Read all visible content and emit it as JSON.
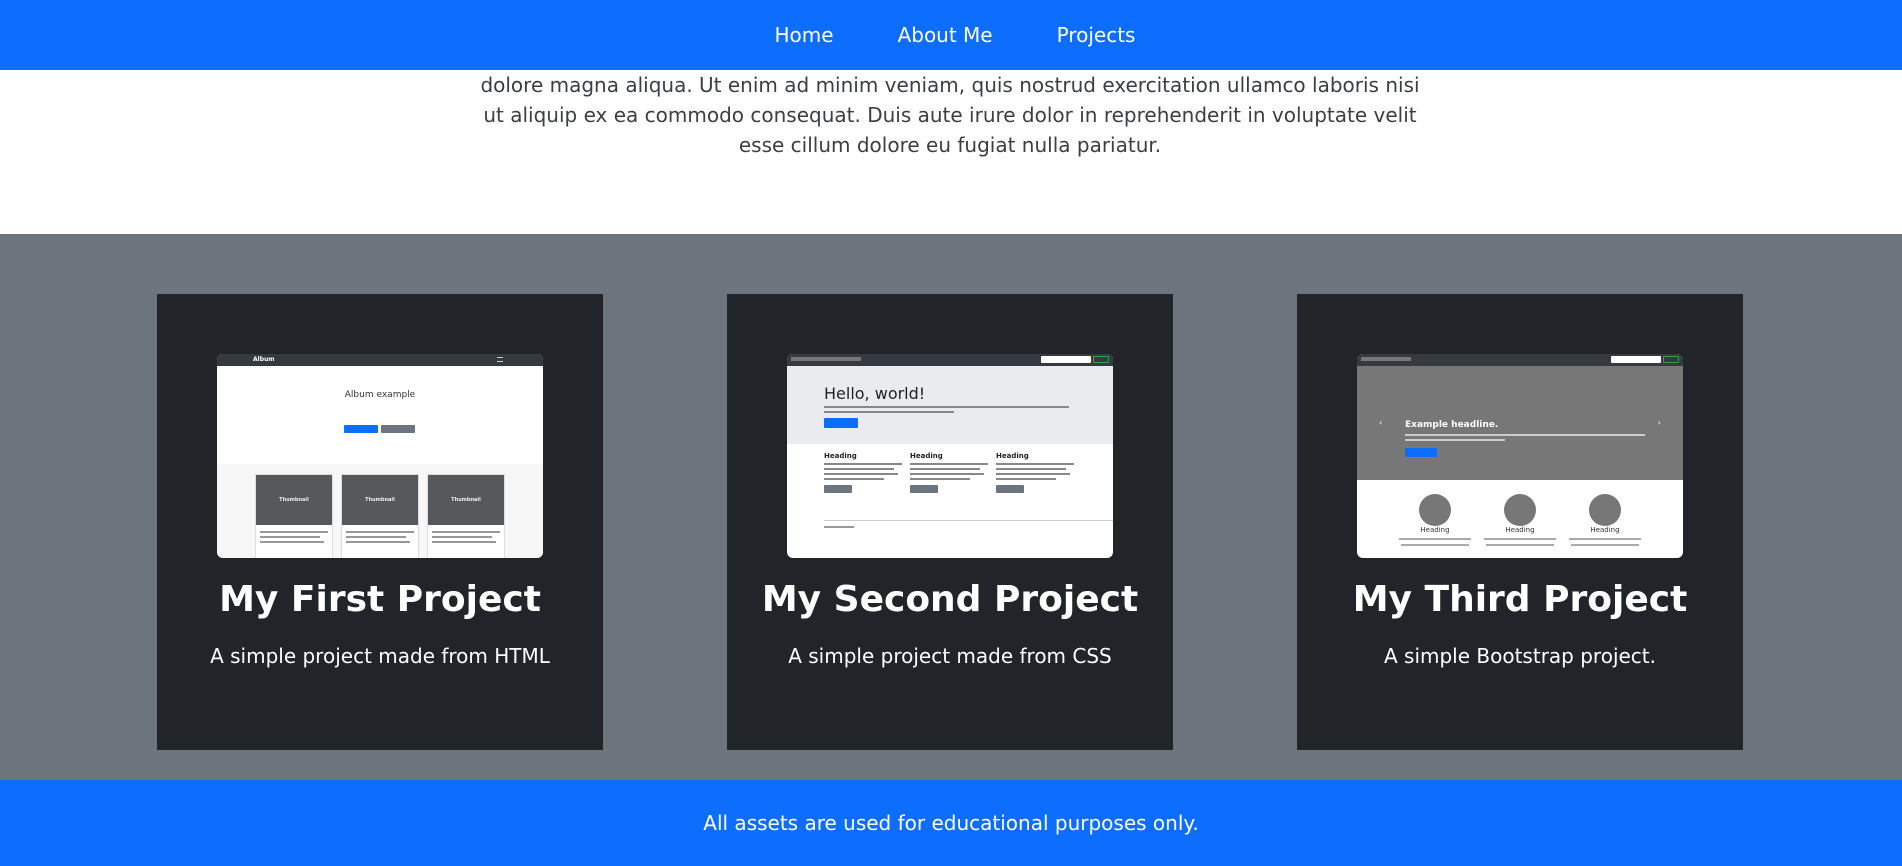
{
  "nav": {
    "links": [
      "Home",
      "About Me",
      "Projects"
    ]
  },
  "intro": {
    "text": "dolore magna aliqua. Ut enim ad minim veniam, quis nostrud exercitation ullamco laboris nisi ut aliquip ex ea commodo consequat. Duis aute irure dolor in reprehenderit in voluptate velit esse cillum dolore eu fugiat nulla pariatur."
  },
  "projects": [
    {
      "title": "My First Project",
      "text": "A simple project made from HTML",
      "thumb": {
        "brand": "Album",
        "heading": "Album example",
        "tile_label": "Thumbnail"
      }
    },
    {
      "title": "My Second Project",
      "text": "A simple project made from CSS",
      "thumb": {
        "heading": "Hello, world!",
        "col_heading": "Heading"
      }
    },
    {
      "title": "My Third Project",
      "text": "A simple Bootstrap project.",
      "thumb": {
        "headline": "Example headline.",
        "col_heading": "Heading"
      }
    }
  ],
  "footer": {
    "text": "All assets are used for educational purposes only."
  },
  "colors": {
    "primary": "#0d6efd",
    "section_bg": "#6c757d",
    "card_bg": "#212529"
  }
}
